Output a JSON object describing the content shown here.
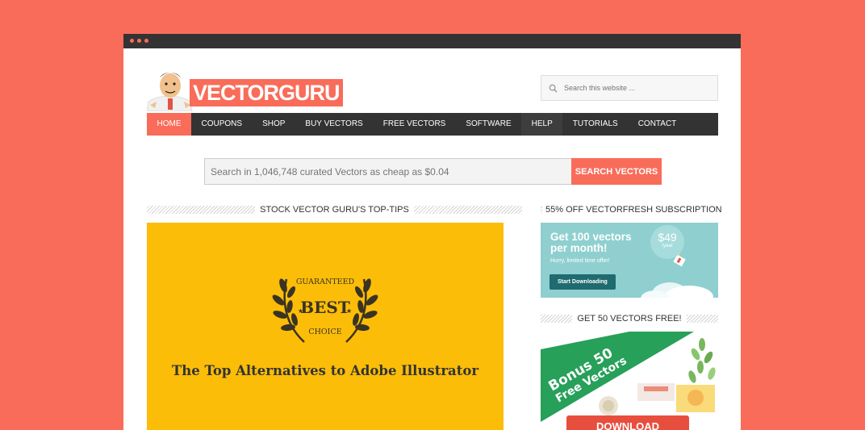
{
  "site": {
    "logo_text": "VECTORGURU"
  },
  "header_search": {
    "placeholder": "Search this website ..."
  },
  "nav": {
    "items": [
      {
        "label": "HOME"
      },
      {
        "label": "COUPONS"
      },
      {
        "label": "SHOP"
      },
      {
        "label": "BUY VECTORS"
      },
      {
        "label": "FREE VECTORS"
      },
      {
        "label": "SOFTWARE"
      },
      {
        "label": "HELP"
      },
      {
        "label": "TUTORIALS"
      },
      {
        "label": "CONTACT"
      }
    ]
  },
  "vector_search": {
    "placeholder": "Search in 1,046,748 curated Vectors as cheap as $0.04",
    "button_label": "SEARCH VECTORS"
  },
  "main": {
    "section_title": "STOCK VECTOR GURU'S TOP-TIPS",
    "feature": {
      "badge_top": "GUARANTEED",
      "badge_main": "BEST",
      "badge_bottom": "CHOICE",
      "title": "The Top Alternatives to Adobe Illustrator"
    }
  },
  "sidebar": {
    "widget1": {
      "title": "55% OFF VECTORFRESH SUBSCRIPTION",
      "ad_headline": "Get 100 vectors per month!",
      "ad_sub": "Hurry, limited time offer!",
      "ad_button": "Start Downloading",
      "price": "$49",
      "price_period": "/year"
    },
    "widget2": {
      "title": "GET 50 VECTORS FREE!",
      "banner_line1": "Bonus 50",
      "banner_line2": "Free Vectors",
      "button": "DOWNLOAD"
    }
  },
  "colors": {
    "background": "#f96c5a",
    "accent": "#f96c5a",
    "nav": "#333333",
    "feature_bg": "#fbbd08",
    "ad_teal": "#8fcfcf",
    "banner_green": "#27a05a"
  }
}
